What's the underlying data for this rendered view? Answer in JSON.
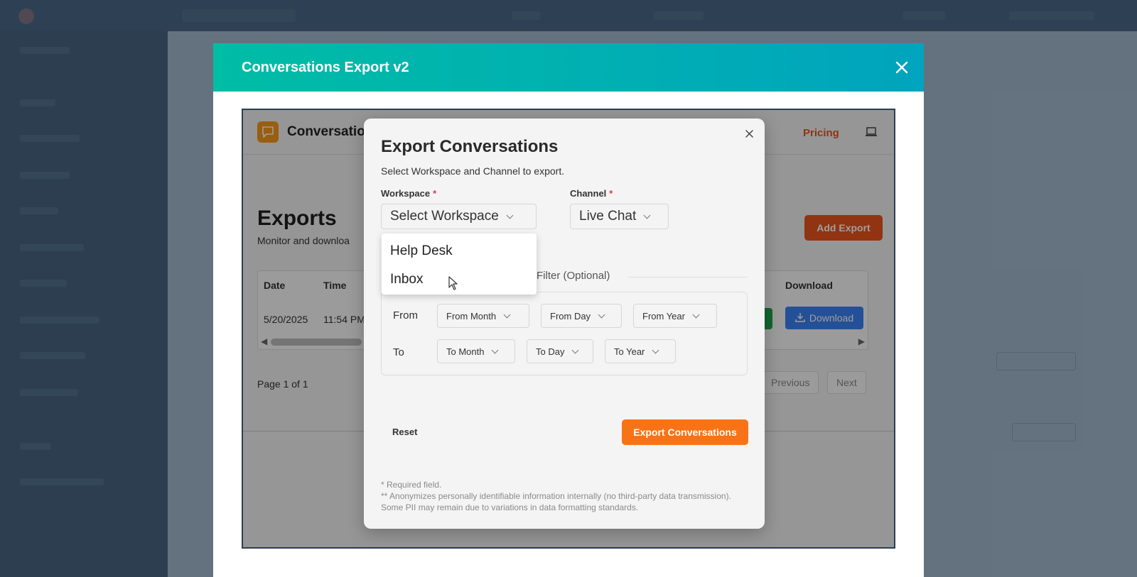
{
  "outer_modal": {
    "title": "Conversations Export v2",
    "close_icon": "close-icon"
  },
  "app": {
    "brand_name": "Conversatio",
    "pricing_label": "Pricing",
    "page_title": "Exports",
    "page_subtitle": "Monitor and downloa",
    "add_export_label": "Add Export",
    "table": {
      "headers": {
        "date": "Date",
        "time": "Time",
        "download": "Download"
      },
      "row": {
        "date": "5/20/2025",
        "time": "11:54 PM",
        "download_label": "Download"
      }
    },
    "pagination": {
      "info": "Page 1 of 1",
      "previous": "Previous",
      "next": "Next"
    }
  },
  "dialog": {
    "title": "Export Conversations",
    "subtitle": "Select Workspace and Channel to export.",
    "workspace": {
      "label": "Workspace",
      "required_mark": "*",
      "value": "Select Workspace",
      "options": [
        "Help Desk",
        "Inbox"
      ]
    },
    "channel": {
      "label": "Channel",
      "required_mark": "*",
      "value": "Live Chat"
    },
    "date_filter": {
      "legend": "Filter (Optional)",
      "from_label": "From",
      "to_label": "To",
      "from_month": "From Month",
      "from_day": "From Day",
      "from_year": "From Year",
      "to_month": "To Month",
      "to_day": "To Day",
      "to_year": "To Year"
    },
    "reset_label": "Reset",
    "export_label": "Export Conversations",
    "footnote_required": "* Required field.",
    "footnote_anonymize": "** Anonymizes personally identifiable information internally (no third-party data transmission). Some PII may remain due to variations in data formatting standards."
  },
  "colors": {
    "header_gradient_start": "#00bda5",
    "header_gradient_end": "#00a4bd",
    "primary_orange": "#f97316",
    "download_blue": "#3b82f6"
  }
}
